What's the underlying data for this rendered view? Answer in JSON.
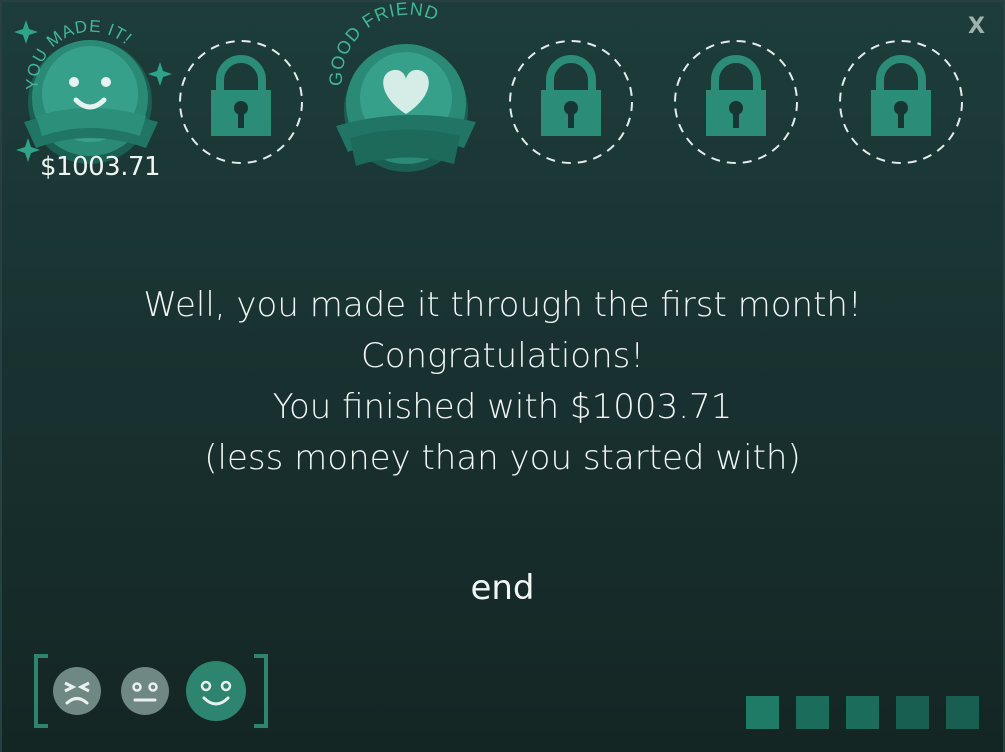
{
  "window": {
    "close_label": "X"
  },
  "badges": [
    {
      "name": "you-made-it",
      "label": "YOU MADE IT!",
      "state": "unlocked",
      "reward": "$1003.71",
      "icon": "smiley-icon"
    },
    {
      "name": "locked-1",
      "state": "locked",
      "icon": "lock-icon"
    },
    {
      "name": "good-friend",
      "label": "GOOD FRIEND",
      "state": "unlocked",
      "icon": "heart-icon"
    },
    {
      "name": "locked-2",
      "state": "locked",
      "icon": "lock-icon"
    },
    {
      "name": "locked-3",
      "state": "locked",
      "icon": "lock-icon"
    },
    {
      "name": "locked-4",
      "state": "locked",
      "icon": "lock-icon"
    }
  ],
  "message": {
    "line1": "Well, you made it through the first month!",
    "line2": "Congratulations!",
    "line3": "You finished with $1003.71",
    "line4": "(less money than you started with)"
  },
  "end_label": "end",
  "mood": {
    "options": [
      "upset-face-icon",
      "neutral-face-icon",
      "happy-face-icon"
    ],
    "selected": "happy-face-icon"
  },
  "progress": {
    "total": 5,
    "current": 1
  },
  "colors": {
    "accent": "#2d8570",
    "badge_dark": "#1d6a5b",
    "badge_light": "#3aa08a",
    "lock": "#2b8c77",
    "text": "#f1f6f5"
  }
}
